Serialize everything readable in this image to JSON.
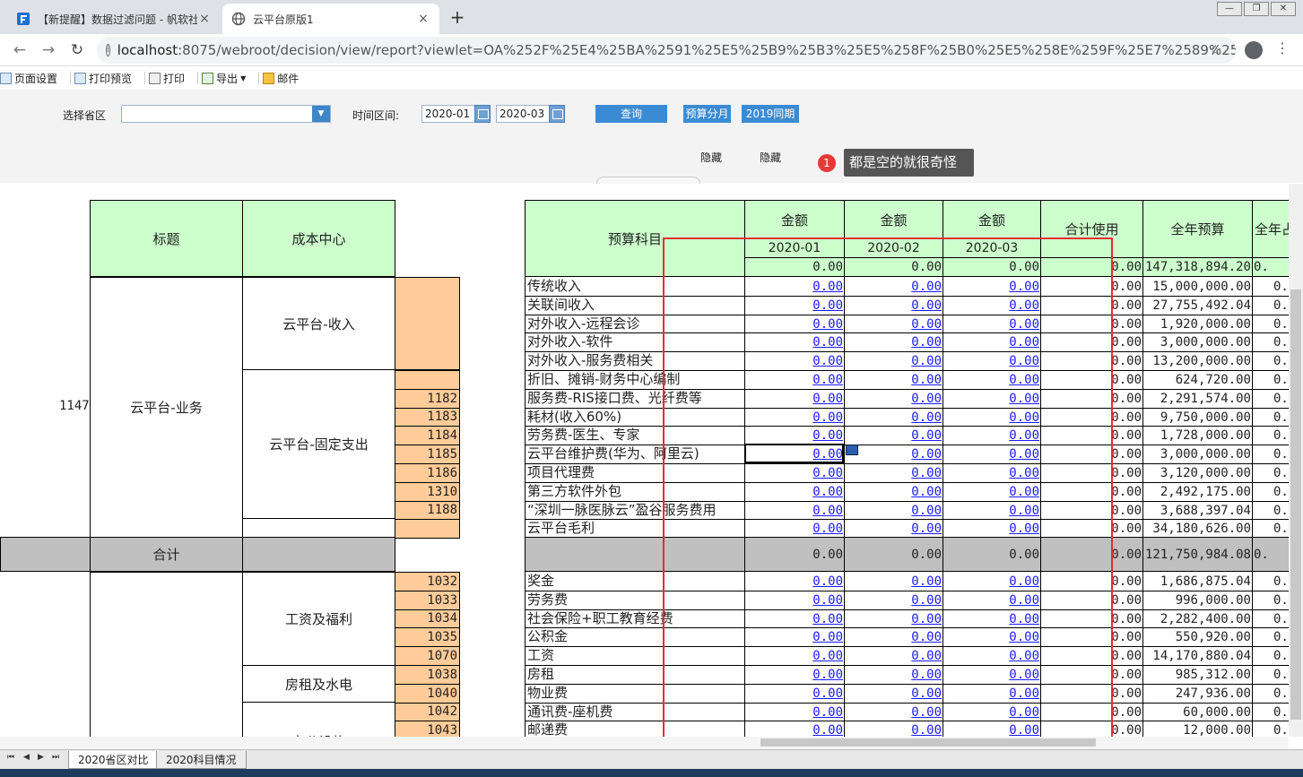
{
  "browser": {
    "tabs": [
      {
        "label": "【新提醒】数据过滤问题 - 帆软社",
        "active": false
      },
      {
        "label": "云平台原版1",
        "active": true
      }
    ],
    "url_host": "localhost",
    "url_rest": ":8075/webroot/decision/view/report?viewlet=OA%252F%25E4%25BA%2591%25E5%25B9%25B3%25E5%258F%25B0%25E5%258E%259F%25E7%2589%2588%25881.cpt&op...",
    "new_tab": "+",
    "close_glyph": "×"
  },
  "toolbar": {
    "items": [
      "页面设置",
      "打印预览",
      "打印",
      "导出",
      "邮件"
    ]
  },
  "params": {
    "province_label": "选择省区",
    "province_value": "",
    "period_label": "时间区间:",
    "date_from": "2020-01",
    "date_to": "2020-03",
    "query_button": "查询",
    "budget_button": "预算分月",
    "same_period_button": "2019同期",
    "hide_1": "隐藏",
    "hide_2": "隐藏",
    "note_count": "1",
    "note_text": "都是空的就很奇怪"
  },
  "report": {
    "header": {
      "title_col": "标题",
      "cost_center_col": "成本中心",
      "subject_col": "预算科目",
      "amount_label": "金额",
      "months": [
        "2020-01",
        "2020-02",
        "2020-03"
      ],
      "total_use": "合计使用",
      "annual_budget": "全年预算",
      "annual_partial": "全年占",
      "summary_values": [
        "0.00",
        "0.00",
        "0.00",
        "0.00",
        "147,318,894.20",
        "0."
      ]
    },
    "group_code": "1147",
    "group_name": "云平台-业务",
    "subgroups": [
      "云平台-收入",
      "云平台-固定支出"
    ],
    "total_label": "合计",
    "total_values": [
      "0.00",
      "0.00",
      "0.00",
      "0.00",
      "121,750,984.08",
      "0."
    ],
    "rows_a": [
      {
        "code": "",
        "subject": "传统收入",
        "budget": "15,000,000.00"
      },
      {
        "code": "",
        "subject": "关联间收入",
        "budget": "27,755,492.04"
      },
      {
        "code": "",
        "subject": "对外收入-远程会诊",
        "budget": "1,920,000.00"
      },
      {
        "code": "",
        "subject": "对外收入-软件",
        "budget": "3,000,000.00"
      },
      {
        "code": "",
        "subject": "对外收入-服务费相关",
        "budget": "13,200,000.00"
      },
      {
        "code": "",
        "subject": "折旧、摊销-财务中心编制",
        "budget": "624,720.00"
      },
      {
        "code": "1182",
        "subject": "服务费-RIS接口费、光纤费等",
        "budget": "2,291,574.00"
      },
      {
        "code": "1183",
        "subject": "耗材(收入60%)",
        "budget": "9,750,000.00"
      },
      {
        "code": "1184",
        "subject": "劳务费-医生、专家",
        "budget": "1,728,000.00"
      },
      {
        "code": "1185",
        "subject": "云平台维护费(华为、阿里云)",
        "budget": "3,000,000.00"
      },
      {
        "code": "1186",
        "subject": "项目代理费",
        "budget": "3,120,000.00"
      },
      {
        "code": "1310",
        "subject": "第三方软件外包",
        "budget": "2,492,175.00"
      },
      {
        "code": "1188",
        "subject": "“深圳一脉医脉云”盈谷服务费用",
        "budget": "3,688,397.04"
      },
      {
        "code": "",
        "subject": "云平台毛利",
        "budget": "34,180,626.00"
      }
    ],
    "subgroups_b": [
      "工资及福利",
      "房租及水电",
      "办公设施"
    ],
    "rows_b": [
      {
        "code": "1032",
        "subject": "奖金",
        "budget": "1,686,875.04"
      },
      {
        "code": "1033",
        "subject": "劳务费",
        "budget": "996,000.00"
      },
      {
        "code": "1034",
        "subject": "社会保险+职工教育经费",
        "budget": "2,282,400.00"
      },
      {
        "code": "1035",
        "subject": "公积金",
        "budget": "550,920.00"
      },
      {
        "code": "1070",
        "subject": "工资",
        "budget": "14,170,880.04"
      },
      {
        "code": "1038",
        "subject": "房租",
        "budget": "985,312.00"
      },
      {
        "code": "1040",
        "subject": "物业费",
        "budget": "247,936.00"
      },
      {
        "code": "1042",
        "subject": "通讯费-座机费",
        "budget": "60,000.00"
      },
      {
        "code": "1043",
        "subject": "邮递费",
        "budget": "12,000.00"
      }
    ],
    "zero": "0.00",
    "partial": "0."
  },
  "sheets": [
    "2020省区对比",
    "2020科目情况"
  ],
  "colors": {
    "green": "#ccffcc",
    "orange": "#ffcc99",
    "gray": "#c0c0c0",
    "highlight": "#e32f2f",
    "button": "#3b8bd4"
  }
}
